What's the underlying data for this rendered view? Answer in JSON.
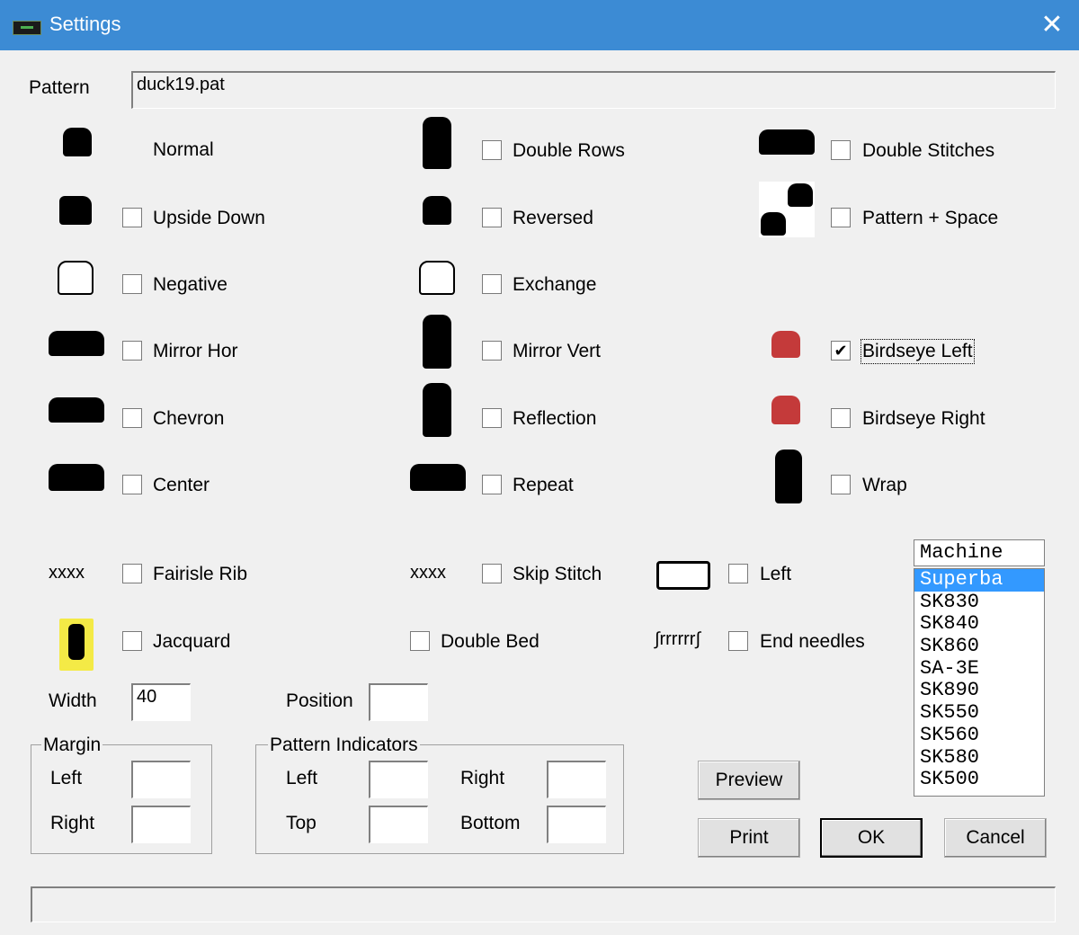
{
  "window": {
    "title": "Settings",
    "close_glyph": "✕"
  },
  "pattern": {
    "label": "Pattern",
    "value": "duck19.pat"
  },
  "options": {
    "normal": "Normal",
    "upside_down": "Upside Down",
    "negative": "Negative",
    "mirror_hor": "Mirror Hor",
    "chevron": "Chevron",
    "center": "Center",
    "fairisle_rib": "Fairisle Rib",
    "jacquard": "Jacquard",
    "double_rows": "Double Rows",
    "reversed": "Reversed",
    "exchange": "Exchange",
    "mirror_vert": "Mirror Vert",
    "reflection": "Reflection",
    "repeat": "Repeat",
    "skip_stitch": "Skip Stitch",
    "double_bed": "Double Bed",
    "double_stitches": "Double Stitches",
    "pattern_space": "Pattern + Space",
    "birdseye_left": "Birdseye Left",
    "birdseye_right": "Birdseye Right",
    "wrap": "Wrap",
    "left": "Left",
    "end_needles": "End needles",
    "birdseye_left_checked": true,
    "check_glyph": "✔"
  },
  "icon_text": {
    "fairisle": "xxxx",
    "skip": "xxxx",
    "needles": "∫rrrrrr∫"
  },
  "width": {
    "label": "Width",
    "value": "40"
  },
  "position": {
    "label": "Position",
    "value": ""
  },
  "margin": {
    "title": "Margin",
    "left": "Left",
    "right": "Right"
  },
  "indicators": {
    "title": "Pattern Indicators",
    "left": "Left",
    "right": "Right",
    "top": "Top",
    "bottom": "Bottom"
  },
  "machine": {
    "title": "Machine",
    "items": [
      "Superba",
      "SK830",
      "SK840",
      "SK860",
      "SA-3E",
      "SK890",
      "SK550",
      "SK560",
      "SK580",
      "SK500"
    ],
    "selected": "Superba"
  },
  "buttons": {
    "preview": "Preview",
    "print": "Print",
    "ok": "OK",
    "cancel": "Cancel"
  },
  "colors": {
    "titlebar": "#3c8bd4",
    "selection": "#3399ff",
    "dialog_bg": "#f0f0f0"
  }
}
